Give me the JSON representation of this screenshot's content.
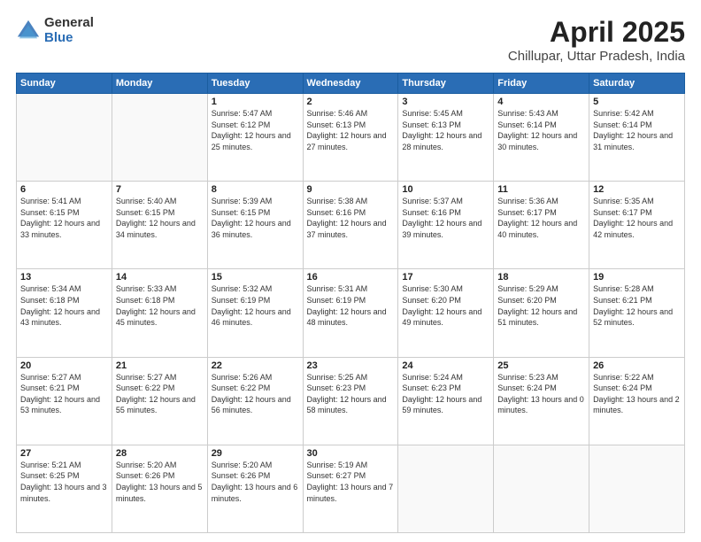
{
  "logo": {
    "general": "General",
    "blue": "Blue"
  },
  "title": "April 2025",
  "subtitle": "Chillupar, Uttar Pradesh, India",
  "weekdays": [
    "Sunday",
    "Monday",
    "Tuesday",
    "Wednesday",
    "Thursday",
    "Friday",
    "Saturday"
  ],
  "weeks": [
    [
      {
        "day": "",
        "sunrise": "",
        "sunset": "",
        "daylight": ""
      },
      {
        "day": "",
        "sunrise": "",
        "sunset": "",
        "daylight": ""
      },
      {
        "day": "1",
        "sunrise": "Sunrise: 5:47 AM",
        "sunset": "Sunset: 6:12 PM",
        "daylight": "Daylight: 12 hours and 25 minutes."
      },
      {
        "day": "2",
        "sunrise": "Sunrise: 5:46 AM",
        "sunset": "Sunset: 6:13 PM",
        "daylight": "Daylight: 12 hours and 27 minutes."
      },
      {
        "day": "3",
        "sunrise": "Sunrise: 5:45 AM",
        "sunset": "Sunset: 6:13 PM",
        "daylight": "Daylight: 12 hours and 28 minutes."
      },
      {
        "day": "4",
        "sunrise": "Sunrise: 5:43 AM",
        "sunset": "Sunset: 6:14 PM",
        "daylight": "Daylight: 12 hours and 30 minutes."
      },
      {
        "day": "5",
        "sunrise": "Sunrise: 5:42 AM",
        "sunset": "Sunset: 6:14 PM",
        "daylight": "Daylight: 12 hours and 31 minutes."
      }
    ],
    [
      {
        "day": "6",
        "sunrise": "Sunrise: 5:41 AM",
        "sunset": "Sunset: 6:15 PM",
        "daylight": "Daylight: 12 hours and 33 minutes."
      },
      {
        "day": "7",
        "sunrise": "Sunrise: 5:40 AM",
        "sunset": "Sunset: 6:15 PM",
        "daylight": "Daylight: 12 hours and 34 minutes."
      },
      {
        "day": "8",
        "sunrise": "Sunrise: 5:39 AM",
        "sunset": "Sunset: 6:15 PM",
        "daylight": "Daylight: 12 hours and 36 minutes."
      },
      {
        "day": "9",
        "sunrise": "Sunrise: 5:38 AM",
        "sunset": "Sunset: 6:16 PM",
        "daylight": "Daylight: 12 hours and 37 minutes."
      },
      {
        "day": "10",
        "sunrise": "Sunrise: 5:37 AM",
        "sunset": "Sunset: 6:16 PM",
        "daylight": "Daylight: 12 hours and 39 minutes."
      },
      {
        "day": "11",
        "sunrise": "Sunrise: 5:36 AM",
        "sunset": "Sunset: 6:17 PM",
        "daylight": "Daylight: 12 hours and 40 minutes."
      },
      {
        "day": "12",
        "sunrise": "Sunrise: 5:35 AM",
        "sunset": "Sunset: 6:17 PM",
        "daylight": "Daylight: 12 hours and 42 minutes."
      }
    ],
    [
      {
        "day": "13",
        "sunrise": "Sunrise: 5:34 AM",
        "sunset": "Sunset: 6:18 PM",
        "daylight": "Daylight: 12 hours and 43 minutes."
      },
      {
        "day": "14",
        "sunrise": "Sunrise: 5:33 AM",
        "sunset": "Sunset: 6:18 PM",
        "daylight": "Daylight: 12 hours and 45 minutes."
      },
      {
        "day": "15",
        "sunrise": "Sunrise: 5:32 AM",
        "sunset": "Sunset: 6:19 PM",
        "daylight": "Daylight: 12 hours and 46 minutes."
      },
      {
        "day": "16",
        "sunrise": "Sunrise: 5:31 AM",
        "sunset": "Sunset: 6:19 PM",
        "daylight": "Daylight: 12 hours and 48 minutes."
      },
      {
        "day": "17",
        "sunrise": "Sunrise: 5:30 AM",
        "sunset": "Sunset: 6:20 PM",
        "daylight": "Daylight: 12 hours and 49 minutes."
      },
      {
        "day": "18",
        "sunrise": "Sunrise: 5:29 AM",
        "sunset": "Sunset: 6:20 PM",
        "daylight": "Daylight: 12 hours and 51 minutes."
      },
      {
        "day": "19",
        "sunrise": "Sunrise: 5:28 AM",
        "sunset": "Sunset: 6:21 PM",
        "daylight": "Daylight: 12 hours and 52 minutes."
      }
    ],
    [
      {
        "day": "20",
        "sunrise": "Sunrise: 5:27 AM",
        "sunset": "Sunset: 6:21 PM",
        "daylight": "Daylight: 12 hours and 53 minutes."
      },
      {
        "day": "21",
        "sunrise": "Sunrise: 5:27 AM",
        "sunset": "Sunset: 6:22 PM",
        "daylight": "Daylight: 12 hours and 55 minutes."
      },
      {
        "day": "22",
        "sunrise": "Sunrise: 5:26 AM",
        "sunset": "Sunset: 6:22 PM",
        "daylight": "Daylight: 12 hours and 56 minutes."
      },
      {
        "day": "23",
        "sunrise": "Sunrise: 5:25 AM",
        "sunset": "Sunset: 6:23 PM",
        "daylight": "Daylight: 12 hours and 58 minutes."
      },
      {
        "day": "24",
        "sunrise": "Sunrise: 5:24 AM",
        "sunset": "Sunset: 6:23 PM",
        "daylight": "Daylight: 12 hours and 59 minutes."
      },
      {
        "day": "25",
        "sunrise": "Sunrise: 5:23 AM",
        "sunset": "Sunset: 6:24 PM",
        "daylight": "Daylight: 13 hours and 0 minutes."
      },
      {
        "day": "26",
        "sunrise": "Sunrise: 5:22 AM",
        "sunset": "Sunset: 6:24 PM",
        "daylight": "Daylight: 13 hours and 2 minutes."
      }
    ],
    [
      {
        "day": "27",
        "sunrise": "Sunrise: 5:21 AM",
        "sunset": "Sunset: 6:25 PM",
        "daylight": "Daylight: 13 hours and 3 minutes."
      },
      {
        "day": "28",
        "sunrise": "Sunrise: 5:20 AM",
        "sunset": "Sunset: 6:26 PM",
        "daylight": "Daylight: 13 hours and 5 minutes."
      },
      {
        "day": "29",
        "sunrise": "Sunrise: 5:20 AM",
        "sunset": "Sunset: 6:26 PM",
        "daylight": "Daylight: 13 hours and 6 minutes."
      },
      {
        "day": "30",
        "sunrise": "Sunrise: 5:19 AM",
        "sunset": "Sunset: 6:27 PM",
        "daylight": "Daylight: 13 hours and 7 minutes."
      },
      {
        "day": "",
        "sunrise": "",
        "sunset": "",
        "daylight": ""
      },
      {
        "day": "",
        "sunrise": "",
        "sunset": "",
        "daylight": ""
      },
      {
        "day": "",
        "sunrise": "",
        "sunset": "",
        "daylight": ""
      }
    ]
  ]
}
